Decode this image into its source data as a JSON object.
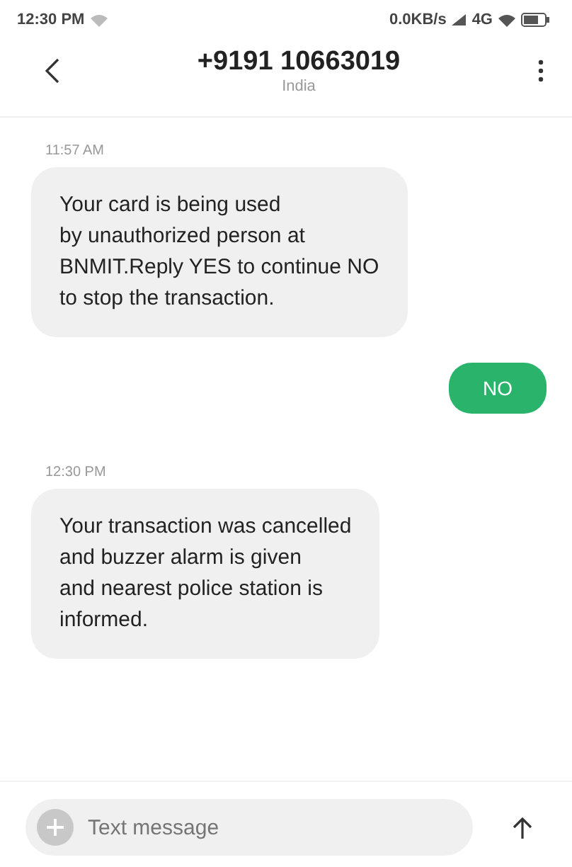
{
  "status_bar": {
    "time": "12:30 PM",
    "speed": "0.0KB/s",
    "network": "4G"
  },
  "header": {
    "title": "+9191 10663019",
    "subtitle": "India"
  },
  "messages": [
    {
      "kind": "time",
      "text": "11:57 AM"
    },
    {
      "kind": "incoming",
      "text": "Your card is being used\nby unauthorized person at\nBNMIT.Reply YES to continue NO\nto stop the transaction."
    },
    {
      "kind": "outgoing",
      "text": "NO"
    },
    {
      "kind": "time",
      "text": "12:30 PM"
    },
    {
      "kind": "incoming",
      "text": "Your transaction was cancelled\nand buzzer alarm is given\nand nearest police station is\ninformed."
    }
  ],
  "composer": {
    "placeholder": "Text message"
  }
}
